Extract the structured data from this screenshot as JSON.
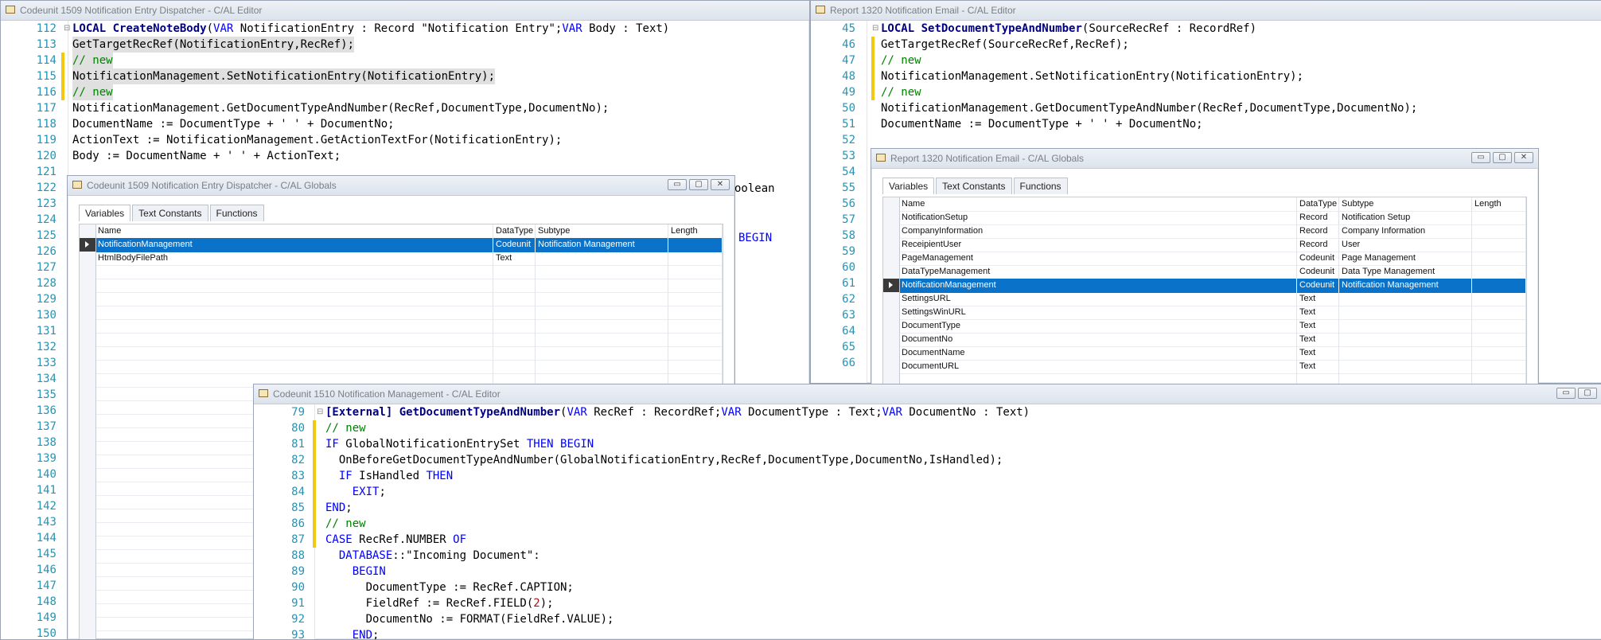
{
  "win1": {
    "title": "Codeunit 1509 Notification Entry Dispatcher - C/AL Editor",
    "lines": [
      {
        "n": "112",
        "c": "LOCAL CreateNoteBody(VAR NotificationEntry : Record \"Notification Entry\";VAR Body : Text)"
      },
      {
        "n": "113",
        "c": "GetTargetRecRef(NotificationEntry,RecRef);"
      },
      {
        "n": "114",
        "c": "// new"
      },
      {
        "n": "115",
        "c": "NotificationManagement.SetNotificationEntry(NotificationEntry);"
      },
      {
        "n": "116",
        "c": "// new"
      },
      {
        "n": "117",
        "c": "NotificationManagement.GetDocumentTypeAndNumber(RecRef,DocumentType,DocumentNo);"
      },
      {
        "n": "118",
        "c": "DocumentName := DocumentType + ' ' + DocumentNo;"
      },
      {
        "n": "119",
        "c": "ActionText := NotificationManagement.GetActionTextFor(NotificationEntry);"
      },
      {
        "n": "120",
        "c": "Body := DocumentName + ' ' + ActionText;"
      },
      {
        "n": "121",
        "c": ""
      },
      {
        "n": "122",
        "c": ""
      },
      {
        "n": "123",
        "c": ""
      },
      {
        "n": "124",
        "c": ""
      },
      {
        "n": "125",
        "c": ""
      },
      {
        "n": "126",
        "c": ""
      },
      {
        "n": "127",
        "c": ""
      },
      {
        "n": "128",
        "c": ""
      },
      {
        "n": "129",
        "c": ""
      },
      {
        "n": "130",
        "c": ""
      },
      {
        "n": "131",
        "c": ""
      },
      {
        "n": "132",
        "c": ""
      },
      {
        "n": "133",
        "c": ""
      },
      {
        "n": "134",
        "c": ""
      },
      {
        "n": "135",
        "c": ""
      },
      {
        "n": "136",
        "c": ""
      },
      {
        "n": "137",
        "c": ""
      },
      {
        "n": "138",
        "c": ""
      },
      {
        "n": "139",
        "c": ""
      },
      {
        "n": "140",
        "c": ""
      },
      {
        "n": "141",
        "c": ""
      },
      {
        "n": "142",
        "c": ""
      },
      {
        "n": "143",
        "c": ""
      },
      {
        "n": "144",
        "c": ""
      },
      {
        "n": "145",
        "c": ""
      },
      {
        "n": "146",
        "c": ""
      },
      {
        "n": "147",
        "c": ""
      },
      {
        "n": "148",
        "c": ""
      },
      {
        "n": "149",
        "c": ""
      },
      {
        "n": "150",
        "c": ""
      }
    ],
    "peek_boolean": "oolean",
    "peek_begin": "BEGIN"
  },
  "dlg1": {
    "title": "Codeunit 1509 Notification Entry Dispatcher - C/AL Globals",
    "tabs": [
      "Variables",
      "Text Constants",
      "Functions"
    ],
    "columns": [
      "Name",
      "DataType",
      "Subtype",
      "Length"
    ],
    "rows": [
      {
        "name": "NotificationManagement",
        "type": "Codeunit",
        "subtype": "Notification Management",
        "length": ""
      },
      {
        "name": "HtmlBodyFilePath",
        "type": "Text",
        "subtype": "",
        "length": ""
      }
    ]
  },
  "win2": {
    "title": "Report 1320 Notification Email - C/AL Editor",
    "lines": [
      {
        "n": "45",
        "c": "LOCAL SetDocumentTypeAndNumber(SourceRecRef : RecordRef)"
      },
      {
        "n": "46",
        "c": "GetTargetRecRef(SourceRecRef,RecRef);"
      },
      {
        "n": "47",
        "c": "// new"
      },
      {
        "n": "48",
        "c": "NotificationManagement.SetNotificationEntry(NotificationEntry);"
      },
      {
        "n": "49",
        "c": "// new"
      },
      {
        "n": "50",
        "c": "NotificationManagement.GetDocumentTypeAndNumber(RecRef,DocumentType,DocumentNo);"
      },
      {
        "n": "51",
        "c": "DocumentName := DocumentType + ' ' + DocumentNo;"
      },
      {
        "n": "52",
        "c": ""
      },
      {
        "n": "53",
        "c": ""
      },
      {
        "n": "54",
        "c": ""
      },
      {
        "n": "55",
        "c": ""
      },
      {
        "n": "56",
        "c": ""
      },
      {
        "n": "57",
        "c": ""
      },
      {
        "n": "58",
        "c": ""
      },
      {
        "n": "59",
        "c": ""
      },
      {
        "n": "60",
        "c": ""
      },
      {
        "n": "61",
        "c": ""
      },
      {
        "n": "62",
        "c": ""
      },
      {
        "n": "63",
        "c": ""
      },
      {
        "n": "64",
        "c": ""
      },
      {
        "n": "65",
        "c": ""
      },
      {
        "n": "66",
        "c": ""
      }
    ]
  },
  "dlg2": {
    "title": "Report 1320 Notification Email - C/AL Globals",
    "tabs": [
      "Variables",
      "Text Constants",
      "Functions"
    ],
    "columns": [
      "Name",
      "DataType",
      "Subtype",
      "Length"
    ],
    "rows": [
      {
        "name": "NotificationSetup",
        "type": "Record",
        "subtype": "Notification Setup",
        "length": ""
      },
      {
        "name": "CompanyInformation",
        "type": "Record",
        "subtype": "Company Information",
        "length": ""
      },
      {
        "name": "ReceipientUser",
        "type": "Record",
        "subtype": "User",
        "length": ""
      },
      {
        "name": "PageManagement",
        "type": "Codeunit",
        "subtype": "Page Management",
        "length": ""
      },
      {
        "name": "DataTypeManagement",
        "type": "Codeunit",
        "subtype": "Data Type Management",
        "length": ""
      },
      {
        "name": "NotificationManagement",
        "type": "Codeunit",
        "subtype": "Notification Management",
        "length": ""
      },
      {
        "name": "SettingsURL",
        "type": "Text",
        "subtype": "",
        "length": ""
      },
      {
        "name": "SettingsWinURL",
        "type": "Text",
        "subtype": "",
        "length": ""
      },
      {
        "name": "DocumentType",
        "type": "Text",
        "subtype": "",
        "length": ""
      },
      {
        "name": "DocumentNo",
        "type": "Text",
        "subtype": "",
        "length": ""
      },
      {
        "name": "DocumentName",
        "type": "Text",
        "subtype": "",
        "length": ""
      },
      {
        "name": "DocumentURL",
        "type": "Text",
        "subtype": "",
        "length": ""
      }
    ]
  },
  "win3": {
    "title": "Codeunit 1510 Notification Management - C/AL Editor",
    "lines": [
      {
        "n": "79",
        "c": "[External] GetDocumentTypeAndNumber(VAR RecRef : RecordRef;VAR DocumentType : Text;VAR DocumentNo : Text)"
      },
      {
        "n": "80",
        "c": "// new"
      },
      {
        "n": "81",
        "c": "IF GlobalNotificationEntrySet THEN BEGIN"
      },
      {
        "n": "82",
        "c": "  OnBeforeGetDocumentTypeAndNumber(GlobalNotificationEntry,RecRef,DocumentType,DocumentNo,IsHandled);"
      },
      {
        "n": "83",
        "c": "  IF IsHandled THEN"
      },
      {
        "n": "84",
        "c": "    EXIT;"
      },
      {
        "n": "85",
        "c": "END;"
      },
      {
        "n": "86",
        "c": "// new"
      },
      {
        "n": "87",
        "c": "CASE RecRef.NUMBER OF"
      },
      {
        "n": "88",
        "c": "  DATABASE::\"Incoming Document\":"
      },
      {
        "n": "89",
        "c": "    BEGIN"
      },
      {
        "n": "90",
        "c": "      DocumentType := RecRef.CAPTION;"
      },
      {
        "n": "91",
        "c": "      FieldRef := RecRef.FIELD(2);"
      },
      {
        "n": "92",
        "c": "      DocumentNo := FORMAT(FieldRef.VALUE);"
      },
      {
        "n": "93",
        "c": "    END;"
      }
    ]
  },
  "window_buttons": {
    "minimize": "▭",
    "maximize": "▢",
    "close": "✕"
  }
}
